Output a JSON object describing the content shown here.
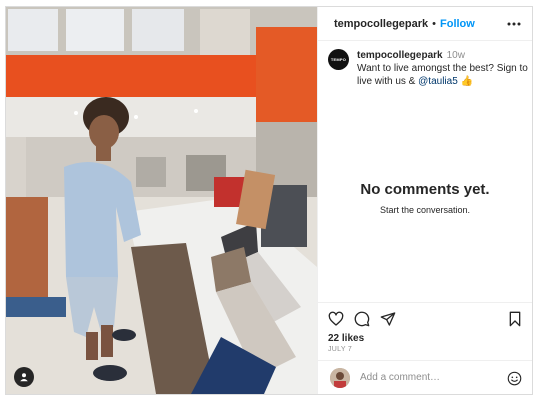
{
  "post": {
    "username": "tempocollegepark",
    "follow_label": "Follow",
    "more_icon": "more-horizontal-icon",
    "separator": "•"
  },
  "caption": {
    "avatar_text": "TEMPO",
    "username": "tempocollegepark",
    "time": "10w",
    "text_before": "Want to live amongst the best? Sign to live with us & ",
    "mention": "@taulia5",
    "emoji": "👍"
  },
  "comments": {
    "empty_title": "No comments yet.",
    "empty_subtitle": "Start the conversation."
  },
  "actions": {
    "icons": [
      "heart-icon",
      "comment-icon",
      "share-icon",
      "bookmark-icon"
    ],
    "likes": "22 likes",
    "date": "JULY 7"
  },
  "comment_box": {
    "placeholder": "Add a comment…",
    "emoji_icon": "smiley-icon"
  },
  "photo": {
    "user_tag_icon": "user-tag-icon",
    "colors": {
      "wall_orange": "#e8501f",
      "floor": "#e8e4de",
      "table": "#f2f2f0",
      "sweater": "#aec4dc"
    }
  }
}
